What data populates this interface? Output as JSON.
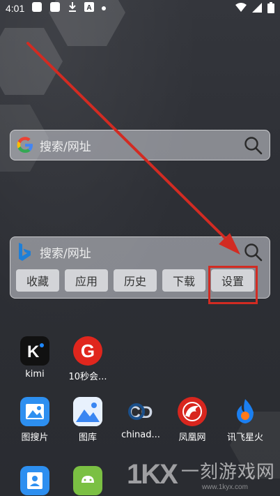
{
  "status_bar": {
    "time": "4:01",
    "icons": [
      "notification-square-icon",
      "notification-square-icon",
      "download-icon",
      "font-icon",
      "dot-icon"
    ],
    "right_icons": [
      "wifi-icon",
      "signal-icon",
      "battery-icon"
    ]
  },
  "google_widget": {
    "engine_icon": "google-icon",
    "placeholder": "搜索/网址"
  },
  "bing_widget": {
    "engine_icon": "bing-icon",
    "placeholder": "搜索/网址",
    "chips": [
      "收藏",
      "应用",
      "历史",
      "下载",
      "设置"
    ]
  },
  "apps_row1": [
    {
      "label": "kimi",
      "icon": "kimi-icon",
      "color": "#111111"
    },
    {
      "label": "10秒会...",
      "icon": "10s-meeting-icon",
      "color": "#e0261d"
    }
  ],
  "apps_row2": [
    {
      "label": "图搜片",
      "icon": "image-search-icon",
      "color": "#2d8ff0"
    },
    {
      "label": "图库",
      "icon": "gallery-icon",
      "color": "#3a86f2"
    },
    {
      "label": "chinad...",
      "icon": "chinadaily-icon",
      "color": "#1a4f8a"
    },
    {
      "label": "凤凰网",
      "icon": "ifeng-icon",
      "color": "#d8261e"
    },
    {
      "label": "讯飞星火",
      "icon": "iflytek-spark-icon",
      "color": "#1b7ff0"
    }
  ],
  "apps_row3": [
    {
      "label": "",
      "icon": "contacts-icon",
      "color": "#2d8ff0"
    },
    {
      "label": "",
      "icon": "android-app-icon",
      "color": "#7bc043"
    }
  ],
  "annotation": {
    "arrow_color": "#d22b22"
  },
  "watermark": {
    "logo": "1KX",
    "cn_text": "一刻游戏网",
    "url": "www.1kyx.com"
  }
}
